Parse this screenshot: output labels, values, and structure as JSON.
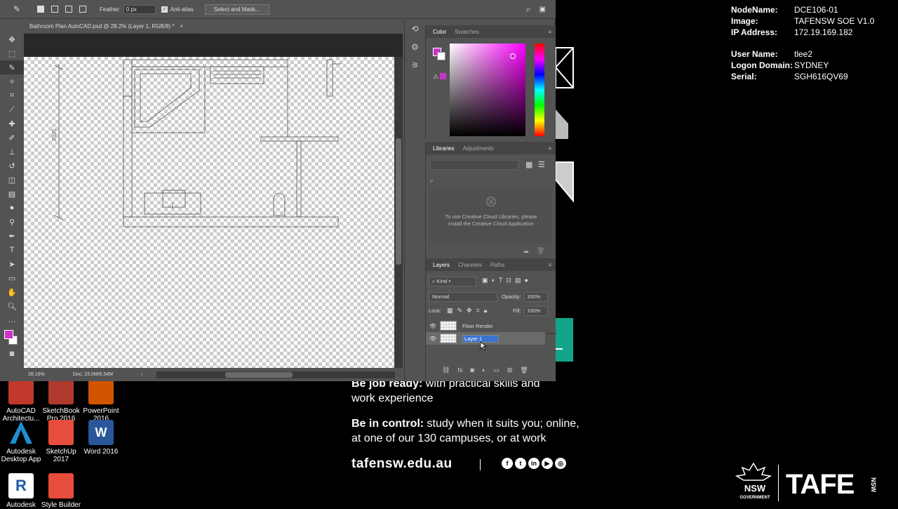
{
  "sysinfo": {
    "node_label": "NodeName:",
    "node": "DCE106-01",
    "image_label": "Image:",
    "image": "TAFENSW SOE V1.0",
    "ip_label": "IP Address:",
    "ip": "172.19.169.182",
    "user_label": "User Name:",
    "user": "tlee2",
    "domain_label": "Logon Domain:",
    "domain": "SYDNEY",
    "serial_label": "Serial:",
    "serial": "SGH616QV69"
  },
  "promo": {
    "line1_bold": "Be job ready:",
    "line1_rest": " with practical skills and",
    "line2": "work experience",
    "line3_bold": "Be in control:",
    "line3_rest": " study when it suits you; online,",
    "line4": "at one of our 130 campuses, or at work",
    "url": "tafensw.edu.au",
    "brand": "TAFE",
    "brand_small": "NSW",
    "nsw": "NSW",
    "gov": "GOVERNMENT"
  },
  "desktop_icons": [
    {
      "label1": "AutoCAD",
      "label2": "Architectu...",
      "color": "#c0392b"
    },
    {
      "label1": "SketchBook",
      "label2": "Pro 2016",
      "color": "#b03a2e"
    },
    {
      "label1": "PowerPoint",
      "label2": "2016",
      "color": "#d35400"
    },
    {
      "label1": "Autodesk",
      "label2": "Desktop App",
      "color": "#1f8fd1"
    },
    {
      "label1": "SketchUp",
      "label2": "2017",
      "color": "#e74c3c"
    },
    {
      "label1": "Word 2016",
      "label2": "",
      "color": "#2b579a"
    },
    {
      "label1": "Autodesk",
      "label2": "",
      "color": "#1e5aa8"
    },
    {
      "label1": "Style Builder",
      "label2": "",
      "color": "#e74c3c"
    }
  ],
  "options": {
    "feather_label": "Feather:",
    "feather_value": "0 px",
    "antialias": "Anti-alias",
    "select_mask": "Select and Mask..."
  },
  "document": {
    "tab_title": "Bathroom Plan AutoCAD.psd @ 28.2% (Layer 1, RGB/8) *",
    "zoom": "28.16%",
    "doc_size": "Doc: 23.0M/6.54M"
  },
  "color_panel": {
    "tab_color": "Color",
    "tab_swatches": "Swatches",
    "fg": "#cc33cc"
  },
  "libraries_panel": {
    "tab_libraries": "Libraries",
    "tab_adjustments": "Adjustments",
    "message": "To use Creative Cloud Libraries, please install the Creative Cloud Application"
  },
  "layers_panel": {
    "tab_layers": "Layers",
    "tab_channels": "Channels",
    "tab_paths": "Paths",
    "kind": "Kind",
    "blend": "Normal",
    "opacity_label": "Opacity:",
    "opacity": "100%",
    "lock_label": "Lock:",
    "fill_label": "Fill:",
    "fill": "100%",
    "layers": [
      {
        "name": "Floor Render"
      },
      {
        "name": "Layer 1"
      }
    ]
  }
}
